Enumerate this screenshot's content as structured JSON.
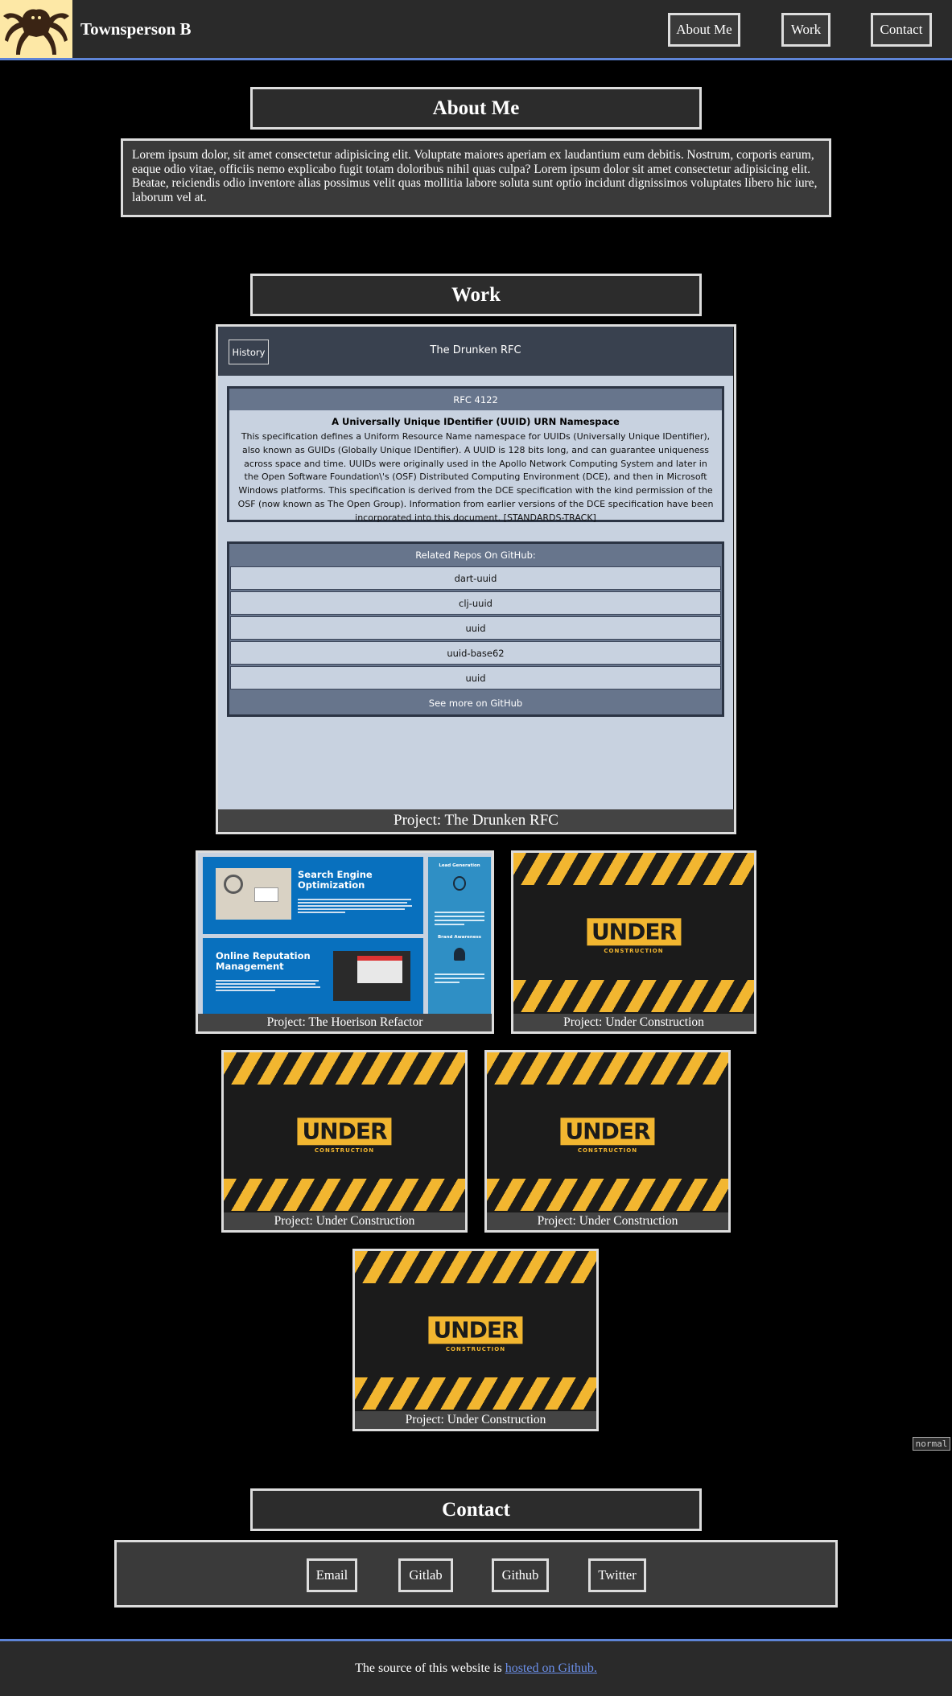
{
  "header": {
    "brand": "Townsperson B",
    "nav": [
      "About Me",
      "Work",
      "Contact"
    ]
  },
  "about": {
    "title": "About Me",
    "text": "Lorem ipsum dolor, sit amet consectetur adipisicing elit. Voluptate maiores aperiam ex laudantium eum debitis. Nostrum, corporis earum, eaque odio vitae, officiis nemo explicabo fugit totam doloribus nihil quas culpa? Lorem ipsum dolor sit amet consectetur adipisicing elit. Beatae, reiciendis odio inventore alias possimus velit quas mollitia labore soluta sunt optio incidunt dignissimos voluptates libero hic iure, laborum vel at."
  },
  "work": {
    "title": "Work",
    "rfc_card": {
      "history_button": "History",
      "site_title": "The Drunken RFC",
      "spec_header": "RFC 4122",
      "spec_title": "A Universally Unique IDentifier (UUID) URN Namespace",
      "spec_body": "This specification defines a Uniform Resource Name namespace for UUIDs (Universally Unique IDentifier), also known as GUIDs (Globally Unique IDentifier). A UUID is 128 bits long, and can guarantee uniqueness across space and time. UUIDs were originally used in the Apollo Network Computing System and later in the Open Software Foundation\\'s (OSF) Distributed Computing Environment (DCE), and then in Microsoft Windows platforms. This specification is derived from the DCE specification with the kind permission of the OSF (now known as The Open Group). Information from earlier versions of the DCE specification have been incorporated into this document. [STANDARDS-TRACK]",
      "repos_header": "Related Repos On GitHub:",
      "repos": [
        "dart-uuid",
        "clj-uuid",
        "uuid",
        "uuid-base62",
        "uuid"
      ],
      "repos_more": "See more on GitHub",
      "caption": "Project: The Drunken RFC"
    },
    "hoerison": {
      "seo_title": "Search Engine Optimization",
      "orm_title": "Online Reputation Management",
      "side_1": "Lead Generation",
      "side_2": "Brand Awareness",
      "caption": "Project: The Hoerison Refactor"
    },
    "under_construction": {
      "word": "UNDER",
      "sub": "CONSTRUCTION",
      "caption": "Project: Under Construction"
    }
  },
  "badge": "normal",
  "contact": {
    "title": "Contact",
    "links": [
      "Email",
      "Gitlab",
      "Github",
      "Twitter"
    ]
  },
  "footer": {
    "text": "The source of this website is",
    "link": "hosted on Github."
  },
  "colors": {
    "accent": "#5e84d6",
    "link": "#6b8fe8",
    "construction_yellow": "#f2b630"
  }
}
